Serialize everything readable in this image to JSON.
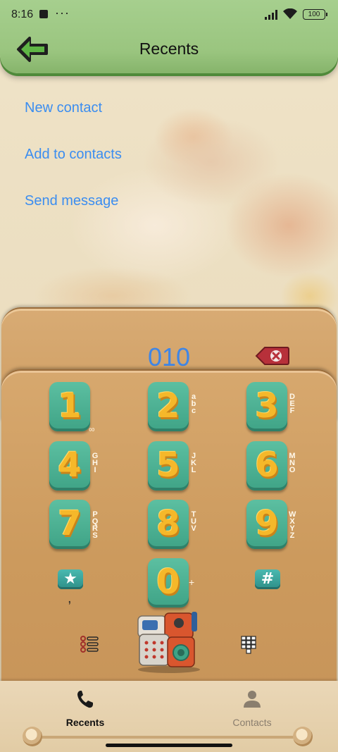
{
  "status_bar": {
    "time": "8:16",
    "more": "···",
    "battery": "100"
  },
  "header": {
    "title": "Recents"
  },
  "menu": {
    "items": [
      {
        "label": "New contact"
      },
      {
        "label": "Add to contacts"
      },
      {
        "label": "Send message"
      }
    ]
  },
  "dialer": {
    "number": "010",
    "keys": [
      {
        "digit": "1",
        "letters": "",
        "sub": "∞"
      },
      {
        "digit": "2",
        "letters": "abc",
        "sub": ""
      },
      {
        "digit": "3",
        "letters": "DEF",
        "sub": ""
      },
      {
        "digit": "4",
        "letters": "GHI",
        "sub": ""
      },
      {
        "digit": "5",
        "letters": "JKL",
        "sub": ""
      },
      {
        "digit": "6",
        "letters": "MNO",
        "sub": ""
      },
      {
        "digit": "7",
        "letters": "PQRS",
        "sub": ""
      },
      {
        "digit": "8",
        "letters": "TUV",
        "sub": ""
      },
      {
        "digit": "9",
        "letters": "WXYZ",
        "sub": ""
      },
      {
        "digit": "0",
        "letters": "",
        "sub": "+"
      }
    ],
    "star": "★",
    "star_sub": ",",
    "hash": "#"
  },
  "bottom_nav": {
    "tabs": [
      {
        "label": "Recents",
        "active": true
      },
      {
        "label": "Contacts",
        "active": false
      }
    ]
  },
  "colors": {
    "header_green": "#9ac57f",
    "link_blue": "#3b8df0",
    "key_teal": "#4fb396",
    "digit_yellow": "#f5b82a",
    "panel_tan": "#d7a86e"
  }
}
